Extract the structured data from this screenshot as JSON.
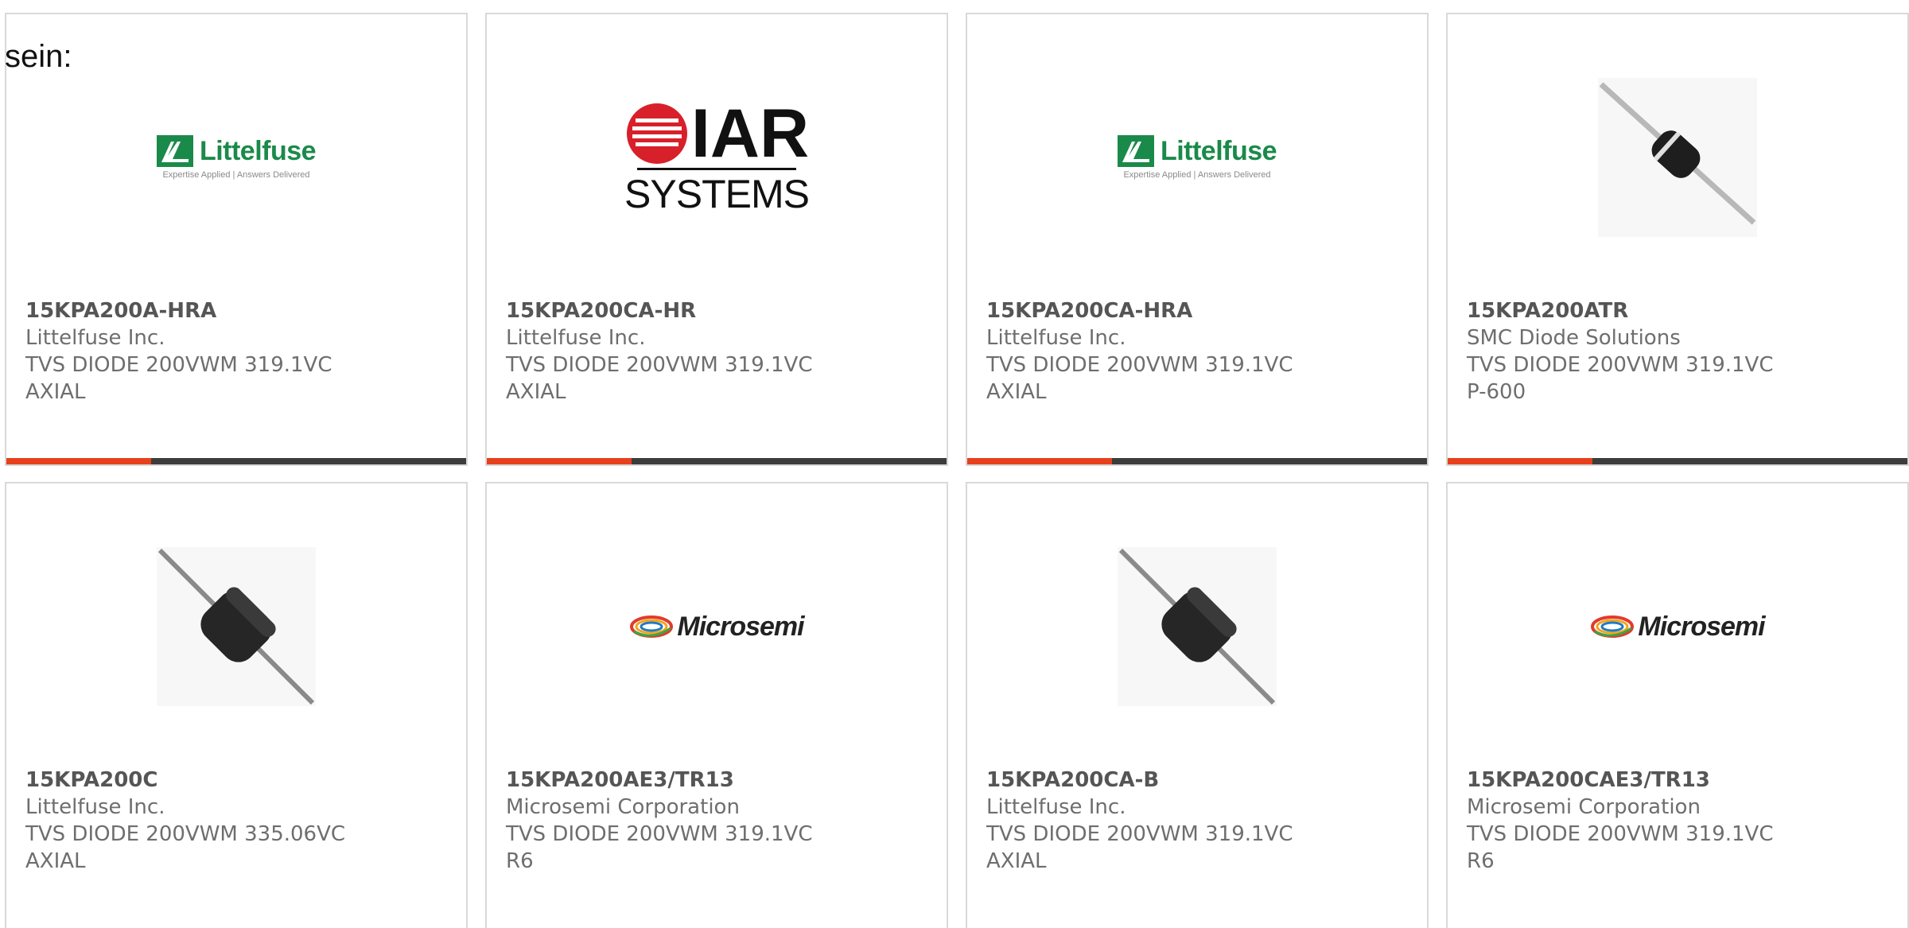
{
  "intro_text": "sein:",
  "colors": {
    "accent": "#e8401c",
    "bar_dark": "#3c3c3c",
    "littelfuse_green": "#1a8a4a"
  },
  "products": [
    {
      "part_number": "15KPA200A-HRA",
      "manufacturer": "Littelfuse Inc.",
      "description": "TVS DIODE 200VWM 319.1VC AXIAL",
      "image": "littelfuse-logo",
      "logo_text": "Littelfuse",
      "logo_tagline": "Expertise Applied | Answers Delivered"
    },
    {
      "part_number": "15KPA200CA-HR",
      "manufacturer": "Littelfuse Inc.",
      "description": "TVS DIODE 200VWM 319.1VC AXIAL",
      "image": "iar-systems-logo",
      "logo_text": "IAR",
      "logo_tagline": "SYSTEMS"
    },
    {
      "part_number": "15KPA200CA-HRA",
      "manufacturer": "Littelfuse Inc.",
      "description": "TVS DIODE 200VWM 319.1VC AXIAL",
      "image": "littelfuse-logo",
      "logo_text": "Littelfuse",
      "logo_tagline": "Expertise Applied | Answers Delivered"
    },
    {
      "part_number": "15KPA200ATR",
      "manufacturer": "SMC Diode Solutions",
      "description": "TVS DIODE 200VWM 319.1VC P-600",
      "image": "axial-diode-photo-small"
    },
    {
      "part_number": "15KPA200C",
      "manufacturer": "Littelfuse Inc.",
      "description": "TVS DIODE 200VWM 335.06VC AXIAL",
      "image": "axial-diode-photo-large"
    },
    {
      "part_number": "15KPA200AE3/TR13",
      "manufacturer": "Microsemi Corporation",
      "description": "TVS DIODE 200VWM 319.1VC R6",
      "image": "microsemi-logo",
      "logo_text": "Microsemi"
    },
    {
      "part_number": "15KPA200CA-B",
      "manufacturer": "Littelfuse Inc.",
      "description": "TVS DIODE 200VWM 319.1VC AXIAL",
      "image": "axial-diode-photo-large"
    },
    {
      "part_number": "15KPA200CAE3/TR13",
      "manufacturer": "Microsemi Corporation",
      "description": "TVS DIODE 200VWM 319.1VC R6",
      "image": "microsemi-logo",
      "logo_text": "Microsemi"
    }
  ]
}
